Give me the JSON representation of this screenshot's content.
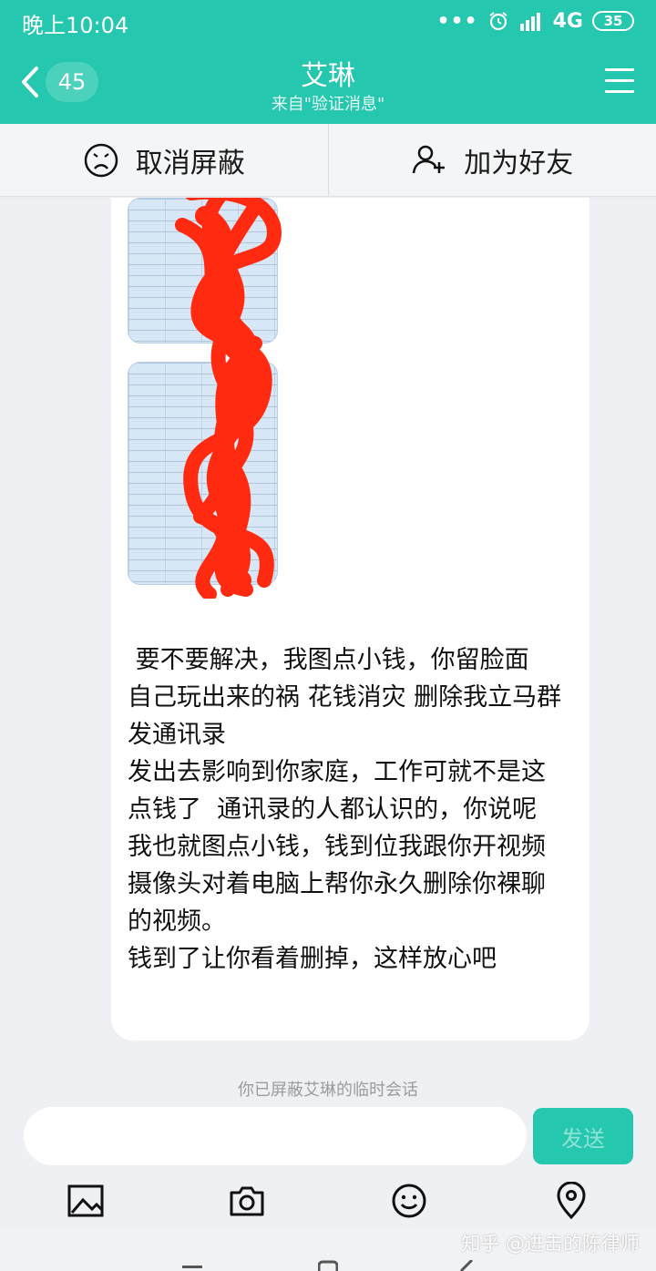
{
  "status": {
    "time": "晚上10:04",
    "signal_dots": "•••",
    "network": "4G",
    "battery": "35"
  },
  "header": {
    "unread_count": "45",
    "title": "艾琳",
    "subtitle": "来自\"验证消息\""
  },
  "actions": {
    "unblock_label": "取消屏蔽",
    "add_friend_label": "加为好友"
  },
  "message": {
    "text": " 要不要解决，我图点小钱，你留脸面  自己玩出来的祸 花钱消灾 删除我立马群发通讯录\n发出去影响到你家庭，工作可就不是这点钱了  通讯录的人都认识的，你说呢\n我也就图点小钱，钱到位我跟你开视频摄像头对着电脑上帮你永久删除你裸聊的视频。\n钱到了让你看着删掉，这样放心吧"
  },
  "system_note": "你已屏蔽艾琳的临时会话",
  "composer": {
    "placeholder": "",
    "send_label": "发送"
  },
  "watermark": "知乎 @进击的陈律师",
  "colors": {
    "accent": "#25c7ae",
    "redaction": "#ff2a10"
  }
}
